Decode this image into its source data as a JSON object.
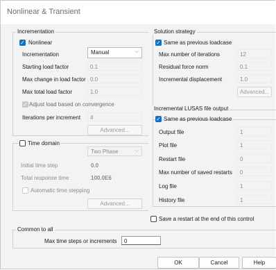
{
  "window": {
    "title": "Nonlinear & Transient"
  },
  "incrementation": {
    "group_label": "Incrementation",
    "nonlinear_label": "Nonlinear",
    "incrementation_label": "Incrementation",
    "incrementation_value": "Manual",
    "starting_load_factor_label": "Starting load factor",
    "starting_load_factor_value": "0.1",
    "max_change_label": "Max change in load factor",
    "max_change_value": "0.0",
    "max_total_label": "Max total load factor",
    "max_total_value": "1.0",
    "adjust_label": "Adjust load based on convergence",
    "iterations_label": "Iterations per increment",
    "iterations_value": "4",
    "advanced_label": "Advanced..."
  },
  "time_domain": {
    "checkbox_label": "Time domain",
    "phase_value": "Two Phase",
    "initial_time_step_label": "Initial time step",
    "initial_time_step_value": "0.0",
    "total_response_time_label": "Total response time",
    "total_response_time_value": "100.0E6",
    "auto_time_stepping_label": "Automatic time stepping",
    "advanced_label": "Advanced..."
  },
  "solution_strategy": {
    "group_label": "Solution strategy",
    "same_as_prev_label": "Same as previous loadcase",
    "max_iterations_label": "Max number of iterations",
    "max_iterations_value": "12",
    "residual_force_label": "Residual force norm",
    "residual_force_value": "0.1",
    "incremental_disp_label": "Incremental displacement",
    "incremental_disp_value": "1.0",
    "advanced_label": "Advanced..."
  },
  "file_output": {
    "group_label": "Incremental LUSAS file output",
    "same_as_prev_label": "Same as previous loadcase",
    "output_file_label": "Output file",
    "output_file_value": "1",
    "plot_file_label": "Plot file",
    "plot_file_value": "1",
    "restart_file_label": "Restart file",
    "restart_file_value": "0",
    "max_restarts_label": "Max number of saved restarts",
    "max_restarts_value": "0",
    "log_file_label": "Log file",
    "log_file_value": "1",
    "history_file_label": "History file",
    "history_file_value": "1"
  },
  "save_restart_label": "Save a restart at the end of this control",
  "common": {
    "group_label": "Common to all",
    "max_steps_label": "Max time steps or increments",
    "max_steps_value": "0"
  },
  "buttons": {
    "ok": "OK",
    "cancel": "Cancel",
    "help": "Help"
  },
  "icons": {
    "check": "check-icon",
    "chevron": "chevron-down-icon"
  },
  "colors": {
    "accent": "#1170c8",
    "background": "#f3f3f3"
  }
}
